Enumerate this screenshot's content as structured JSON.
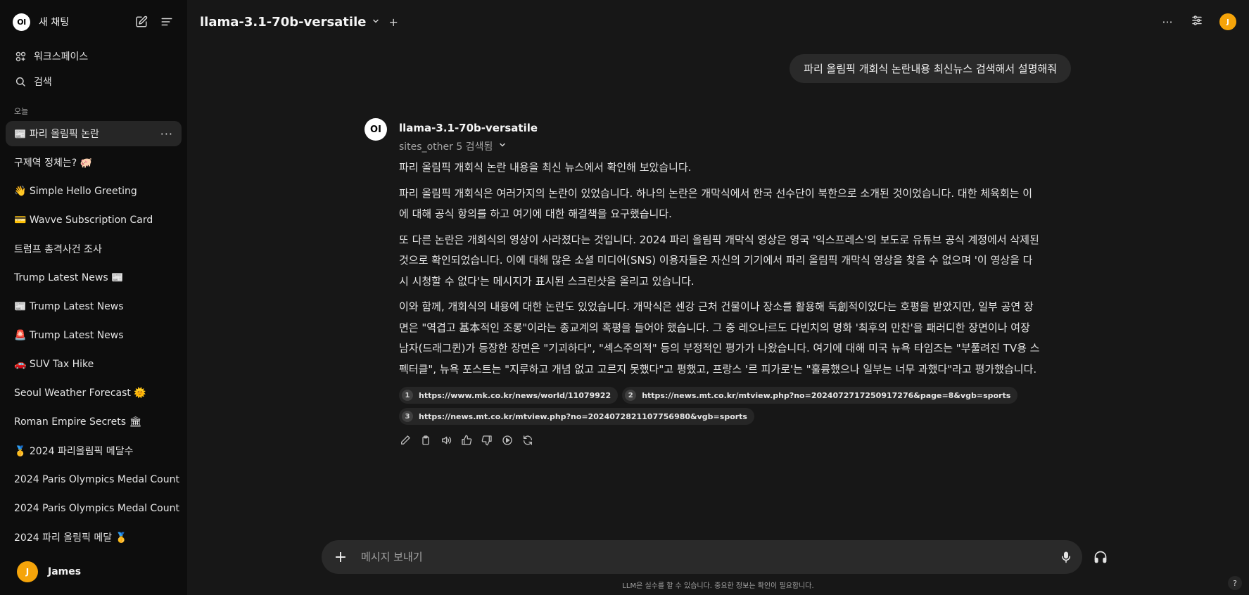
{
  "sidebar": {
    "logo_text": "OI",
    "new_chat_label": "새 채팅",
    "links": [
      {
        "label": "워크스페이스",
        "icon": "workspace-icon"
      },
      {
        "label": "검색",
        "icon": "search-icon"
      }
    ],
    "section_label": "오늘",
    "chats": [
      {
        "label": "📰 파리 올림픽 논란",
        "active": true
      },
      {
        "label": "구제역 정체는? 🐖"
      },
      {
        "label": "👋 Simple Hello Greeting"
      },
      {
        "label": "💳 Wavve Subscription Card"
      },
      {
        "label": "트럼프 총격사건 조사"
      },
      {
        "label": "Trump Latest News 📰"
      },
      {
        "label": "📰 Trump Latest News"
      },
      {
        "label": "🚨 Trump Latest News"
      },
      {
        "label": "🚗 SUV Tax Hike"
      },
      {
        "label": "Seoul Weather Forecast 🌞"
      },
      {
        "label": "Roman Empire Secrets 🏛"
      },
      {
        "label": "🥇 2024 파리올림픽 메달수"
      },
      {
        "label": "2024 Paris Olympics Medal Count"
      },
      {
        "label": "2024 Paris Olympics Medal Count"
      },
      {
        "label": "2024 파리 올림픽 메달 🥇"
      }
    ],
    "user": {
      "initial": "J",
      "name": "James"
    }
  },
  "header": {
    "model": "llama-3.1-70b-versatile",
    "avatar_initial": "J"
  },
  "user_message": "파리 올림픽 개회식 논란내용 최신뉴스 검색해서 설명해줘",
  "assistant": {
    "logo_text": "OI",
    "name": "llama-3.1-70b-versatile",
    "search_status": "sites_other 5 검색됨",
    "paragraphs": [
      "파리 올림픽 개회식 논란 내용을 최신 뉴스에서 확인해 보았습니다.",
      "파리 올림픽 개회식은 여러가지의 논란이 있었습니다. 하나의 논란은 개막식에서 한국 선수단이 북한으로 소개된 것이었습니다. 대한 체육회는 이에 대해 공식 항의를 하고 여기에 대한 해결책을 요구했습니다.",
      "또 다른 논란은 개회식의 영상이 사라졌다는 것입니다. 2024 파리 올림픽 개막식 영상은 영국 '익스프레스'의 보도로 유튜브 공식 계정에서 삭제된 것으로 확인되었습니다. 이에 대해 많은 소셜 미디어(SNS) 이용자들은 자신의 기기에서 파리 올림픽 개막식 영상을 찾을 수 없으며 '이 영상을 다시 시청할 수 없다'는 메시지가 표시된 스크린샷을 올리고 있습니다.",
      "이와 함께, 개회식의 내용에 대한 논란도 있었습니다. 개막식은 센강 근처 건물이나 장소를 활용해 독創적이었다는 호평을 받았지만, 일부 공연 장면은 \"역겹고 基本적인 조롱\"이라는 종교계의 혹평을 들어야 했습니다. 그 중 레오나르도 다빈치의 명화 '최후의 만찬'을 패러디한 장면이나 여장 남자(드래그퀸)가 등장한 장면은 \"기괴하다\", \"섹스주의적\" 등의 부정적인 평가가 나왔습니다. 여기에 대해 미국 뉴욕 타임즈는 \"부풀려진 TV용 스펙터클\", 뉴욕 포스트는 \"지루하고 개념 없고 고르지 못했다\"고 평했고, 프랑스 '르 피가로'는 \"훌륭했으나 일부는 너무 과했다\"라고 평가했습니다."
    ],
    "sources": [
      {
        "num": "1",
        "url": "https://www.mk.co.kr/news/world/11079922"
      },
      {
        "num": "2",
        "url": "https://news.mt.co.kr/mtview.php?no=2024072717250917276&page=8&vgb=sports"
      },
      {
        "num": "3",
        "url": "https://news.mt.co.kr/mtview.php?no=2024072821107756980&vgb=sports"
      }
    ]
  },
  "input": {
    "placeholder": "메시지 보내기"
  },
  "disclaimer": "LLM은 실수를 할 수 있습니다. 중요한 정보는 확인이 필요합니다.",
  "help_label": "?"
}
